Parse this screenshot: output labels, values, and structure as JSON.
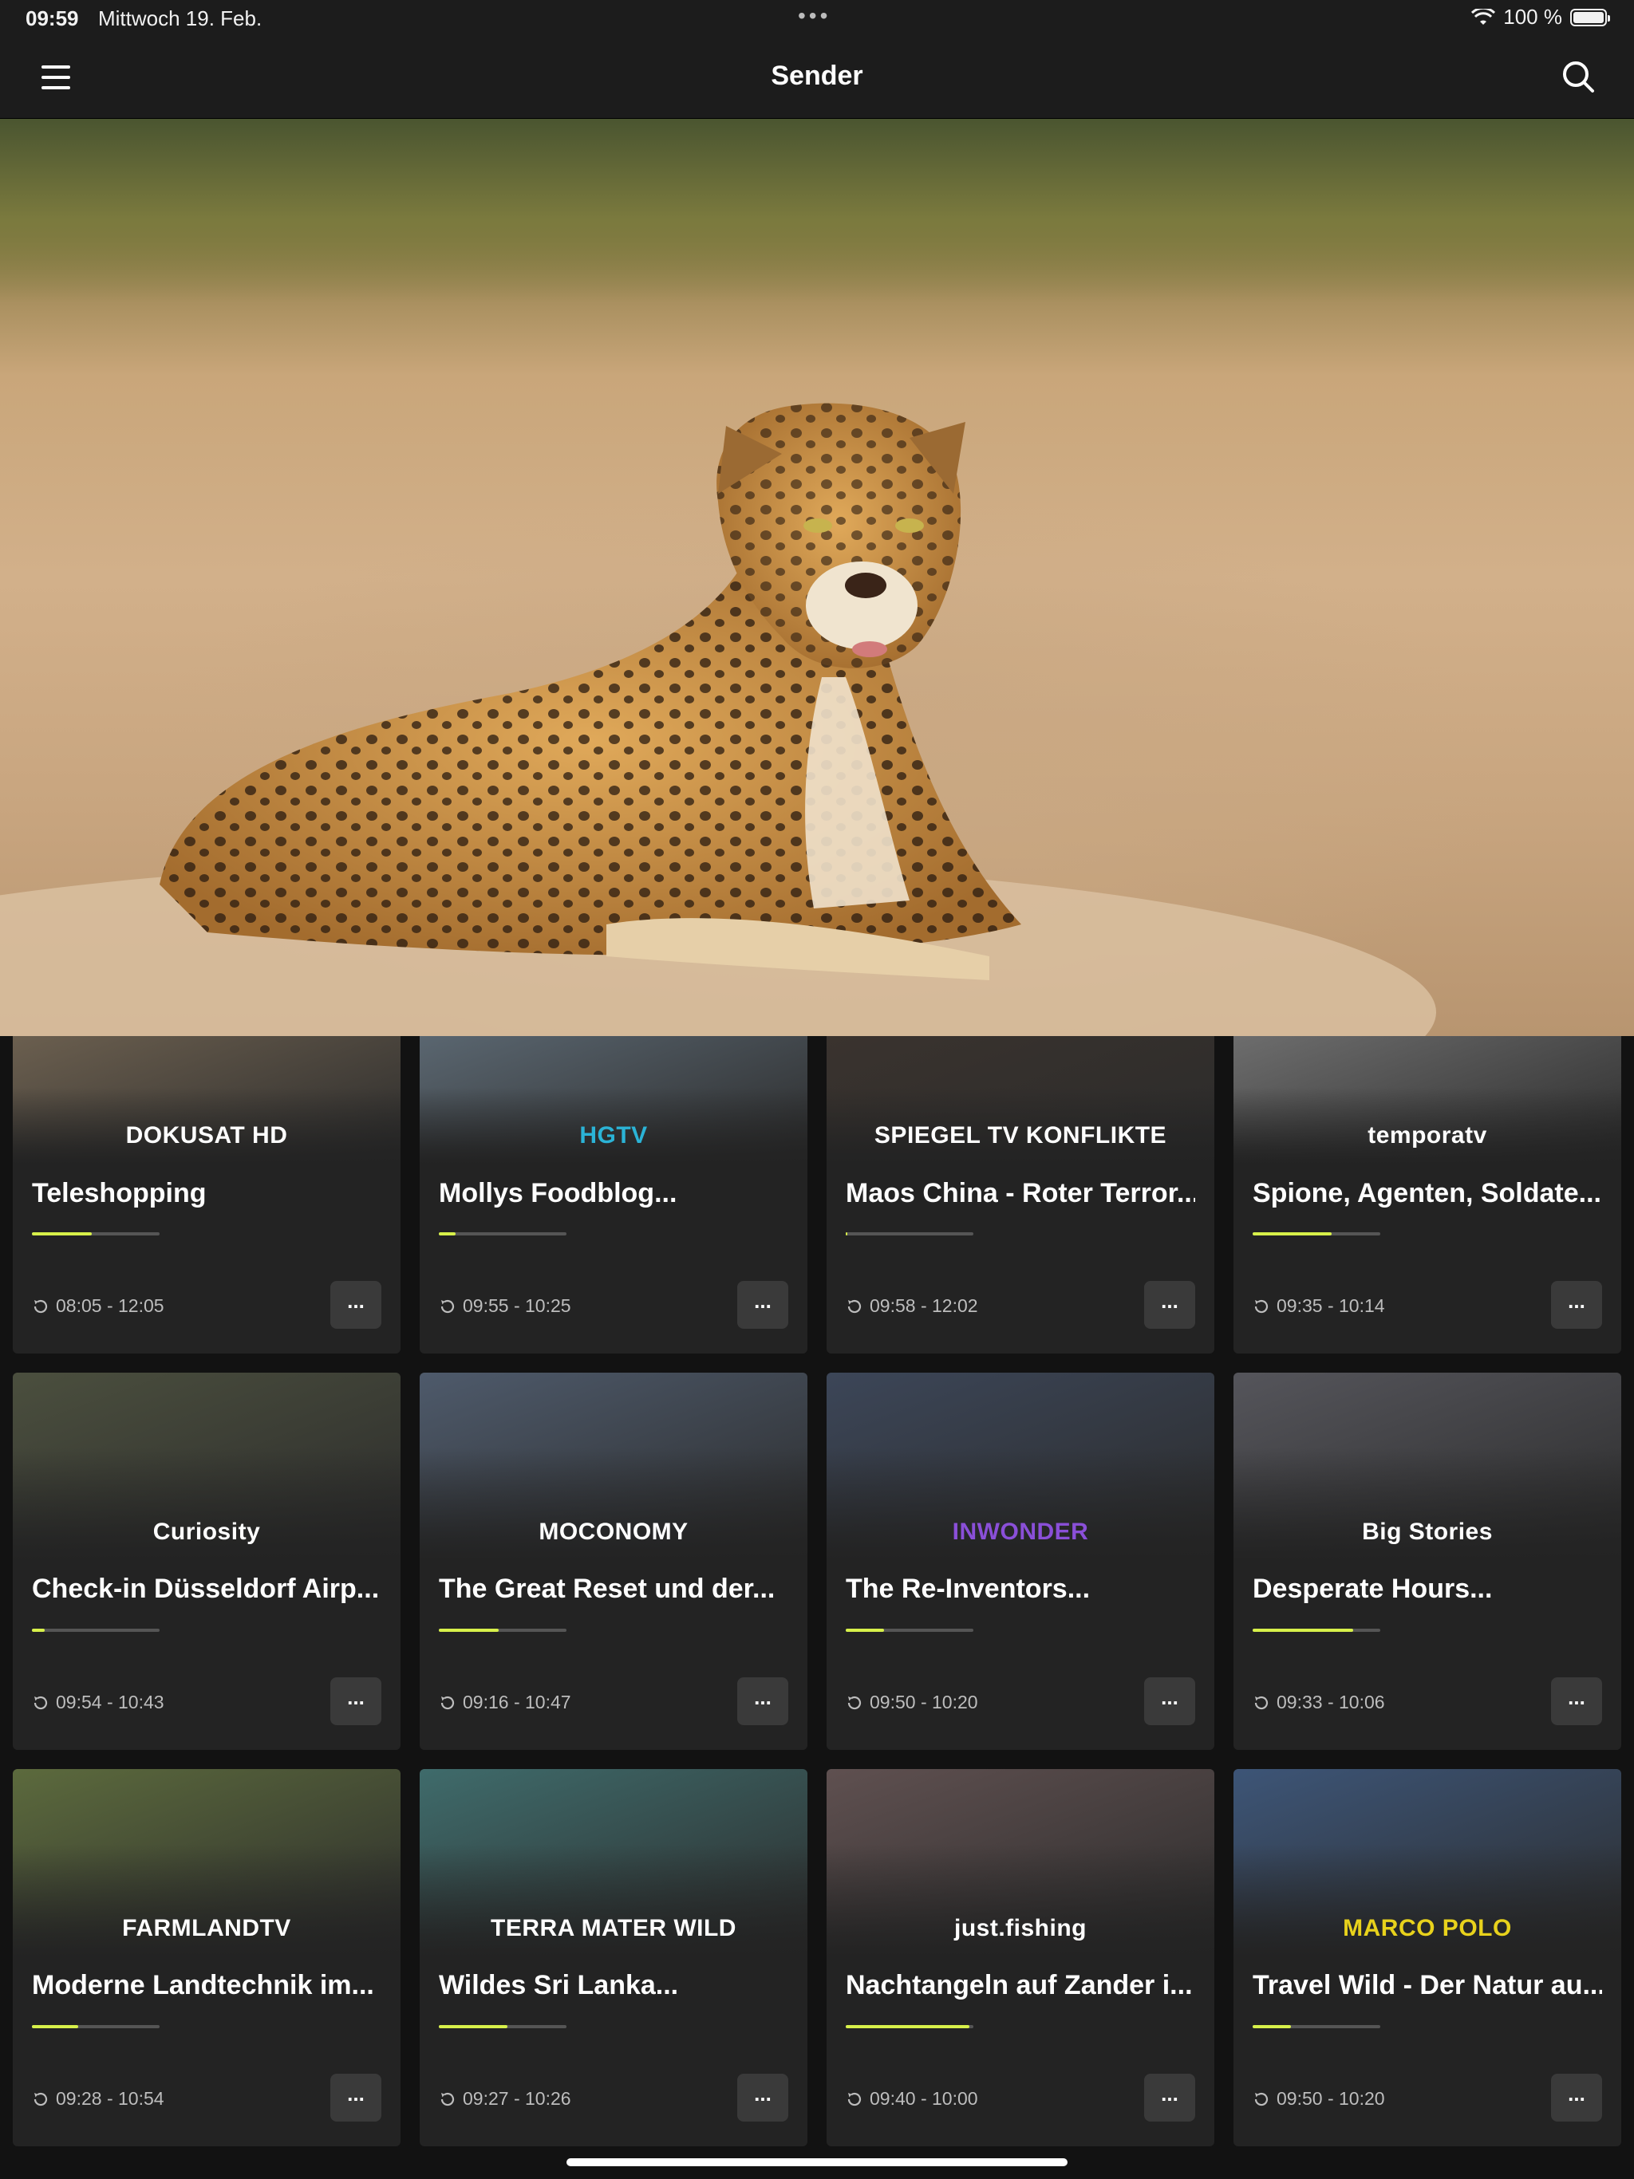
{
  "status": {
    "time": "09:59",
    "date": "Mittwoch 19. Feb.",
    "battery": "100 %"
  },
  "nav": {
    "title": "Sender"
  },
  "channels": [
    {
      "logo": "DOKUSAT HD",
      "title": "Teleshopping",
      "time": "08:05 - 12:05",
      "progress": 0.47,
      "more": "...",
      "thumb": "#6b5f4f"
    },
    {
      "logo": "HGTV",
      "title": "Mollys Foodblog...",
      "time": "09:55 - 10:25",
      "progress": 0.13,
      "more": "...",
      "thumb": "#5a6670",
      "logoColor": "#2bb3d6"
    },
    {
      "logo": "SPIEGEL TV KONFLIKTE",
      "title": "Maos China - Roter Terror...",
      "time": "09:58 - 12:02",
      "progress": 0.01,
      "more": "...",
      "thumb": "#3a332e"
    },
    {
      "logo": "temporatv",
      "title": "Spione, Agenten, Soldate...",
      "time": "09:35 - 10:14",
      "progress": 0.62,
      "more": "...",
      "thumb": "#6d6d6d"
    },
    {
      "logo": "Curiosity",
      "title": "Check-in Düsseldorf Airp...",
      "time": "09:54 - 10:43",
      "progress": 0.1,
      "more": "...",
      "thumb": "#4b4f3e"
    },
    {
      "logo": "MOCONOMY",
      "title": "The Great Reset und der...",
      "time": "09:16 - 10:47",
      "progress": 0.47,
      "more": "...",
      "thumb": "#4e5a6b"
    },
    {
      "logo": "INWONDER",
      "title": "The Re-Inventors...",
      "time": "09:50 - 10:20",
      "progress": 0.3,
      "more": "...",
      "thumb": "#3c4658",
      "logoColor": "#8a4fd8"
    },
    {
      "logo": "Big Stories",
      "title": "Desperate Hours...",
      "time": "09:33 - 10:06",
      "progress": 0.79,
      "more": "...",
      "thumb": "#55555b"
    },
    {
      "logo": "FARMLANDTV",
      "title": "Moderne Landtechnik im...",
      "time": "09:28 - 10:54",
      "progress": 0.36,
      "more": "...",
      "thumb": "#5c6a3d"
    },
    {
      "logo": "TERRA MATER WILD",
      "title": "Wildes Sri Lanka...",
      "time": "09:27 - 10:26",
      "progress": 0.54,
      "more": "...",
      "thumb": "#3f6b6b"
    },
    {
      "logo": "just.fishing",
      "title": "Nachtangeln auf Zander i...",
      "time": "09:40 - 10:00",
      "progress": 0.97,
      "more": "...",
      "thumb": "#5f5050"
    },
    {
      "logo": "MARCO POLO",
      "title": "Travel Wild - Der Natur au...",
      "time": "09:50 - 10:20",
      "progress": 0.3,
      "more": "...",
      "thumb": "#3d5577",
      "logoColor": "#e8d21c"
    }
  ],
  "colors": {
    "accent": "#d7f04a",
    "card": "#232323",
    "background": "#121212"
  },
  "icons": {
    "menu": "hamburger-icon",
    "search": "search-icon",
    "replay": "replay-icon",
    "more": "more-icon"
  }
}
